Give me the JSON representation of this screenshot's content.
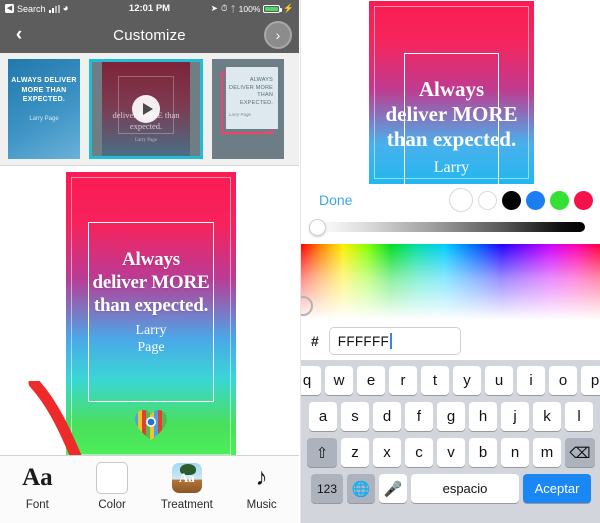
{
  "status_bar": {
    "back_label": "Search",
    "back_icon": "chevron-left-icon",
    "signal_icon": "signal-bars-icon",
    "wifi_icon": "wifi-icon",
    "time": "12:01 PM",
    "location_icon": "location-arrow-icon",
    "alarm_icon": "alarm-icon",
    "bluetooth_icon": "bluetooth-icon",
    "battery_percent": "100%",
    "battery_icon": "battery-full-icon",
    "charging_icon": "lightning-bolt-icon"
  },
  "nav_bar": {
    "back_icon": "chevron-left-icon",
    "title": "Customize",
    "next_icon": "chevron-right-circle-icon"
  },
  "thumbnails": [
    {
      "name": "template-blue-gradient",
      "quote": "ALWAYS DELIVER MORE THAN EXPECTED.",
      "author": "Larry Page",
      "selected": "false"
    },
    {
      "name": "template-video-red",
      "quote": "deliver MORE than expected.",
      "author": "Larry Page",
      "play_icon": "play-icon",
      "selected": "true"
    },
    {
      "name": "template-gray-pink-frame",
      "quote": "ALWAYS DELIVER MORE THAN EXPECTED.",
      "author": "Larry Page",
      "selected": "false"
    }
  ],
  "preview": {
    "quote_line_1": "Always",
    "quote_line_2": "deliver MORE",
    "quote_line_3": "than expected.",
    "author_line_1": "Larry",
    "author_line_2": "Page",
    "logo_icon": "rainbow-heart-logo",
    "gradient_top": "#FB1B52",
    "gradient_mid": "#4AA8E8",
    "gradient_bottom": "#4CF05A"
  },
  "annotation": {
    "arrow_icon": "red-curved-arrow-annotation",
    "arrow_color": "#EE2A2A"
  },
  "toolbar": {
    "items": [
      {
        "label": "Font",
        "icon": "font-aa-icon"
      },
      {
        "label": "Color",
        "icon": "color-swatch-icon"
      },
      {
        "label": "Treatment",
        "icon": "treatment-image-icon"
      },
      {
        "label": "Music",
        "icon": "music-note-icon"
      }
    ]
  },
  "right_preview": {
    "quote_line_1": "Always",
    "quote_line_2": "deliver MORE",
    "quote_line_3": "than expected.",
    "author": "Larry"
  },
  "color_picker": {
    "done_label": "Done",
    "swatches": [
      {
        "name": "swatch-white-selected",
        "color": "#FFFFFF",
        "selected": "true"
      },
      {
        "name": "swatch-white",
        "color": "#FFFFFF",
        "selected": "false"
      },
      {
        "name": "swatch-black",
        "color": "#000000",
        "selected": "false"
      },
      {
        "name": "swatch-blue",
        "color": "#1A7EF0",
        "selected": "false"
      },
      {
        "name": "swatch-green",
        "color": "#33E033",
        "selected": "false"
      },
      {
        "name": "swatch-red",
        "color": "#F5124A",
        "selected": "false"
      }
    ],
    "brightness_slider": {
      "name": "brightness-slider",
      "value": "0"
    },
    "gradient_area_name": "hue-saturation-gradient",
    "picker_ring_name": "color-picker-ring",
    "hex_prefix": "#",
    "hex_value": "FFFFFF",
    "hex_placeholder": "FFFFFF"
  },
  "keyboard": {
    "row1": [
      "q",
      "w",
      "e",
      "r",
      "t",
      "y",
      "u",
      "i",
      "o",
      "p"
    ],
    "row2": [
      "a",
      "s",
      "d",
      "f",
      "g",
      "h",
      "j",
      "k",
      "l"
    ],
    "row3": [
      "z",
      "x",
      "c",
      "v",
      "b",
      "n",
      "m"
    ],
    "shift_icon": "shift-up-arrow-icon",
    "backspace_icon": "backspace-delete-icon",
    "numbers_label": "123",
    "globe_icon": "globe-language-icon",
    "mic_icon": "microphone-icon",
    "space_label": "espacio",
    "accept_label": "Aceptar",
    "accept_color": "#1A87F5"
  }
}
